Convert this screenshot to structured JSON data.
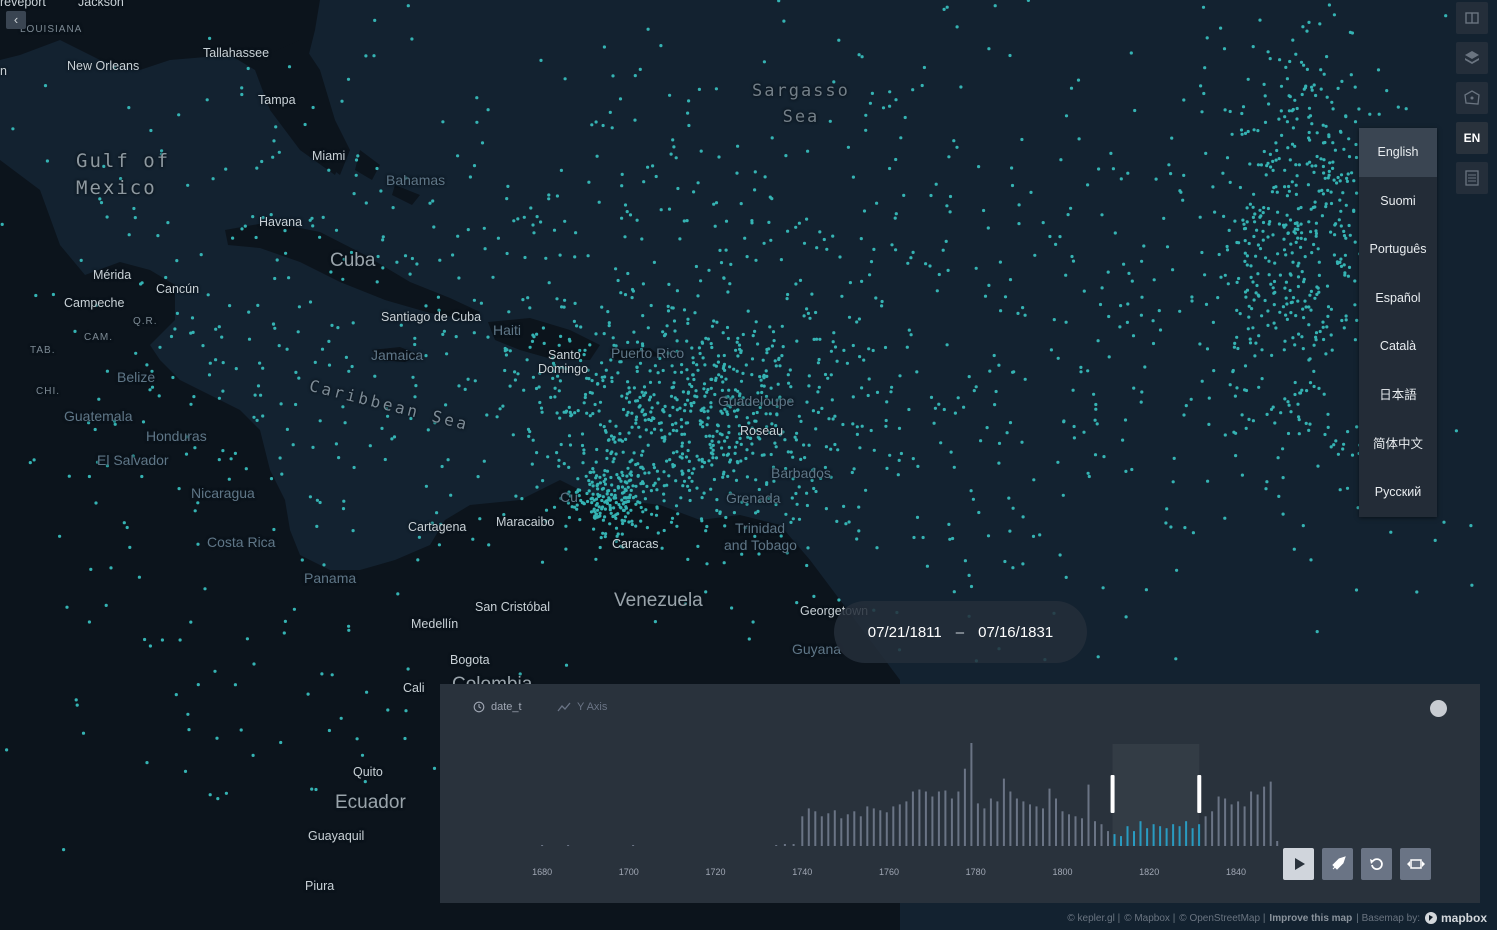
{
  "map": {
    "places": [
      {
        "id": "shreveport",
        "label": "reveport"
      },
      {
        "id": "jackson",
        "label": "Jackson"
      },
      {
        "id": "louisiana",
        "label": "LOUISIANA"
      },
      {
        "id": "tallahassee",
        "label": "Tallahassee"
      },
      {
        "id": "new-orleans",
        "label": "New Orleans"
      },
      {
        "id": "n",
        "label": "n"
      },
      {
        "id": "tampa",
        "label": "Tampa"
      },
      {
        "id": "miami",
        "label": "Miami"
      },
      {
        "id": "bahamas",
        "label": "Bahamas"
      },
      {
        "id": "havana",
        "label": "Havana"
      },
      {
        "id": "cuba",
        "label": "Cuba"
      },
      {
        "id": "merida",
        "label": "Mérida"
      },
      {
        "id": "cancun",
        "label": "Cancún"
      },
      {
        "id": "campeche",
        "label": "Campeche"
      },
      {
        "id": "qr",
        "label": "Q.R."
      },
      {
        "id": "cam",
        "label": "CAM."
      },
      {
        "id": "tab",
        "label": "TAB."
      },
      {
        "id": "chi",
        "label": "CHI."
      },
      {
        "id": "santiago",
        "label": "Santiago de Cuba"
      },
      {
        "id": "haiti",
        "label": "Haiti"
      },
      {
        "id": "jamaica",
        "label": "Jamaica"
      },
      {
        "id": "santo",
        "label": "Santo"
      },
      {
        "id": "domingo",
        "label": "Domingo"
      },
      {
        "id": "puerto-rico",
        "label": "Puerto Rico"
      },
      {
        "id": "belize",
        "label": "Belize"
      },
      {
        "id": "guatemala",
        "label": "Guatemala"
      },
      {
        "id": "honduras",
        "label": "Honduras"
      },
      {
        "id": "el-salvador",
        "label": "El Salvador"
      },
      {
        "id": "nicaragua",
        "label": "Nicaragua"
      },
      {
        "id": "costa-rica",
        "label": "Costa Rica"
      },
      {
        "id": "panama",
        "label": "Panama"
      },
      {
        "id": "guadeloupe",
        "label": "Guadeloupe"
      },
      {
        "id": "roseau",
        "label": "Roseau"
      },
      {
        "id": "barbados",
        "label": "Barbados"
      },
      {
        "id": "grenada",
        "label": "Grenada"
      },
      {
        "id": "trinidad",
        "label": "Trinidad"
      },
      {
        "id": "tobago",
        "label": "and Tobago"
      },
      {
        "id": "curacao",
        "label": "Cu"
      },
      {
        "id": "cartagena",
        "label": "Cartagena"
      },
      {
        "id": "maracaibo",
        "label": "Maracaibo"
      },
      {
        "id": "caracas",
        "label": "Caracas"
      },
      {
        "id": "venezuela",
        "label": "Venezuela"
      },
      {
        "id": "georgetown",
        "label": "Georgetown"
      },
      {
        "id": "guyana",
        "label": "Guyana"
      },
      {
        "id": "san-cristobal",
        "label": "San Cristóbal"
      },
      {
        "id": "medellin",
        "label": "Medellín"
      },
      {
        "id": "bogota",
        "label": "Bogota"
      },
      {
        "id": "colombia",
        "label": "Colombia"
      },
      {
        "id": "cali",
        "label": "Cali"
      },
      {
        "id": "quito",
        "label": "Quito"
      },
      {
        "id": "ecuador",
        "label": "Ecuador"
      },
      {
        "id": "guayaquil",
        "label": "Guayaquil"
      },
      {
        "id": "piura",
        "label": "Piura"
      }
    ],
    "gulf_line1": "Gulf of",
    "gulf_line2": "Mexico",
    "sargasso_line1": "Sargasso",
    "sargasso_line2": "Sea",
    "caribbean": "Caribbean Sea",
    "point_color": "#35b3b3",
    "land_color": "#0c141c",
    "water_color": "#152330"
  },
  "map_controls": {
    "collapse_icon": "chevron-left-icon",
    "split_icon": "split-map-icon",
    "layers_icon": "layer-stack-icon",
    "draw_icon": "draw-polygon-icon",
    "lang_label": "EN",
    "legend_icon": "legend-icon"
  },
  "language_menu": {
    "items": [
      "English",
      "Suomi",
      "Português",
      "Español",
      "Català",
      "日本語",
      "简体中文",
      "Русский"
    ],
    "selected": "English"
  },
  "time_range": {
    "start": "07/21/1811",
    "end": "07/16/1831",
    "separator": "–"
  },
  "timeline": {
    "field_name": "date_t",
    "y_axis_label": "Y Axis",
    "x_ticks": [
      "1680",
      "1700",
      "1720",
      "1740",
      "1760",
      "1780",
      "1800",
      "1820",
      "1840"
    ],
    "bar_color": "#6a7485",
    "selected_bar_color": "#1e96be",
    "buttons": [
      "play-icon",
      "speed-icon",
      "reset-icon",
      "window-icon"
    ]
  },
  "chart_data": {
    "type": "bar",
    "x_label": "date_t",
    "xlim": [
      1665,
      1852
    ],
    "ylim": [
      0,
      105
    ],
    "selection": [
      1811.55,
      1831.54
    ],
    "bins": [
      [
        1680,
        1
      ],
      [
        1686,
        1
      ],
      [
        1701,
        1
      ],
      [
        1734,
        1
      ],
      [
        1736,
        2
      ],
      [
        1738,
        2
      ],
      [
        1740,
        30
      ],
      [
        1741.5,
        38
      ],
      [
        1743,
        35
      ],
      [
        1744.5,
        30
      ],
      [
        1746,
        33
      ],
      [
        1747.5,
        36
      ],
      [
        1749,
        28
      ],
      [
        1750.5,
        32
      ],
      [
        1752,
        35
      ],
      [
        1753.5,
        30
      ],
      [
        1755,
        40
      ],
      [
        1756.5,
        38
      ],
      [
        1758,
        36
      ],
      [
        1759.5,
        34
      ],
      [
        1761,
        40
      ],
      [
        1762.5,
        42
      ],
      [
        1764,
        45
      ],
      [
        1765.5,
        55
      ],
      [
        1767,
        57
      ],
      [
        1768.5,
        55
      ],
      [
        1770,
        50
      ],
      [
        1771.5,
        55
      ],
      [
        1773,
        56
      ],
      [
        1774.5,
        48
      ],
      [
        1776,
        55
      ],
      [
        1777.5,
        78
      ],
      [
        1779,
        104
      ],
      [
        1780.5,
        43
      ],
      [
        1782,
        38
      ],
      [
        1783.5,
        48
      ],
      [
        1785,
        45
      ],
      [
        1786.5,
        68
      ],
      [
        1788,
        55
      ],
      [
        1789.5,
        48
      ],
      [
        1791,
        45
      ],
      [
        1792.5,
        42
      ],
      [
        1794,
        40
      ],
      [
        1795.5,
        38
      ],
      [
        1797,
        58
      ],
      [
        1798.5,
        48
      ],
      [
        1800,
        35
      ],
      [
        1801.5,
        32
      ],
      [
        1803,
        30
      ],
      [
        1804.5,
        28
      ],
      [
        1806,
        62
      ],
      [
        1807.5,
        25
      ],
      [
        1809,
        22
      ],
      [
        1810.5,
        15
      ],
      [
        1812,
        12
      ],
      [
        1813.5,
        10
      ],
      [
        1815,
        20
      ],
      [
        1816.5,
        15
      ],
      [
        1818,
        25
      ],
      [
        1819.5,
        18
      ],
      [
        1821,
        22
      ],
      [
        1822.5,
        20
      ],
      [
        1824,
        18
      ],
      [
        1825.5,
        22
      ],
      [
        1827,
        20
      ],
      [
        1828.5,
        25
      ],
      [
        1830,
        18
      ],
      [
        1831.5,
        22
      ],
      [
        1833,
        30
      ],
      [
        1834.5,
        35
      ],
      [
        1836,
        50
      ],
      [
        1837.5,
        48
      ],
      [
        1839,
        42
      ],
      [
        1840.5,
        45
      ],
      [
        1842,
        40
      ],
      [
        1843.5,
        55
      ],
      [
        1845,
        52
      ],
      [
        1846.5,
        60
      ],
      [
        1848,
        65
      ],
      [
        1849.5,
        5
      ]
    ]
  },
  "attribution": {
    "kepler": "© kepler.gl |",
    "mapbox": "© Mapbox |",
    "osm": "© OpenStreetMap |",
    "improve": "Improve this map",
    "basemap": "| Basemap by:",
    "logo": "mapbox"
  }
}
